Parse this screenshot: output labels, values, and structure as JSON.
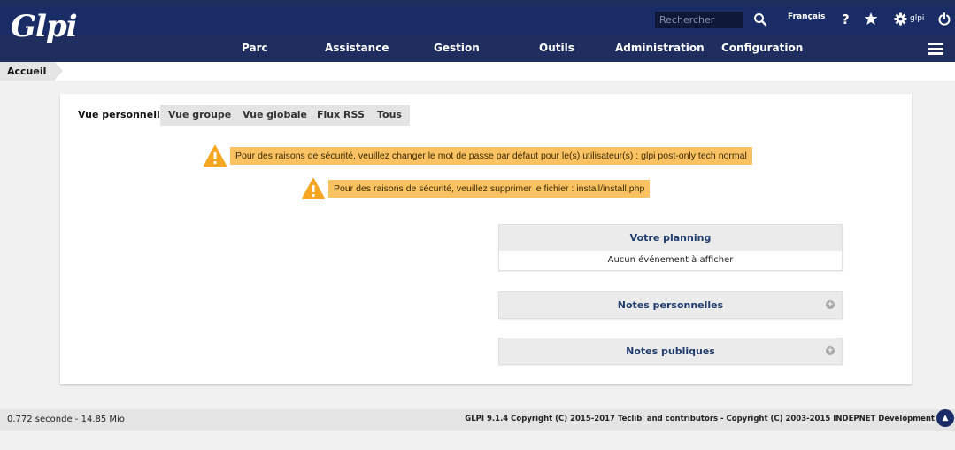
{
  "header": {
    "logo_text": "Glpi",
    "search_placeholder": "Rechercher",
    "language": "Français",
    "user": "glpi"
  },
  "menu": [
    "Parc",
    "Assistance",
    "Gestion",
    "Outils",
    "Administration",
    "Configuration"
  ],
  "breadcrumb": "Accueil",
  "tabs": [
    "Vue personnelle",
    "Vue groupe",
    "Vue globale",
    "Flux RSS",
    "Tous"
  ],
  "warnings": [
    "Pour des raisons de sécurité, veuillez changer le mot de passe par défaut pour le(s) utilisateur(s) : glpi post-only tech normal",
    "Pour des raisons de sécurité, veuillez supprimer le fichier : install/install.php"
  ],
  "planning": {
    "title": "Votre planning",
    "empty": "Aucun événement à afficher"
  },
  "notes_personal": "Notes personnelles",
  "notes_public": "Notes publiques",
  "footer": {
    "timing": "0.772 seconde - 14.85 Mio",
    "copyright": "GLPI 9.1.4 Copyright (C) 2015-2017 Teclib' and contributors - Copyright (C) 2003-2015 INDEPNET Development"
  },
  "colors": {
    "header_bg": "#1a2c66",
    "warning_bg": "#fbc263",
    "link_blue": "#1f3b6c"
  }
}
